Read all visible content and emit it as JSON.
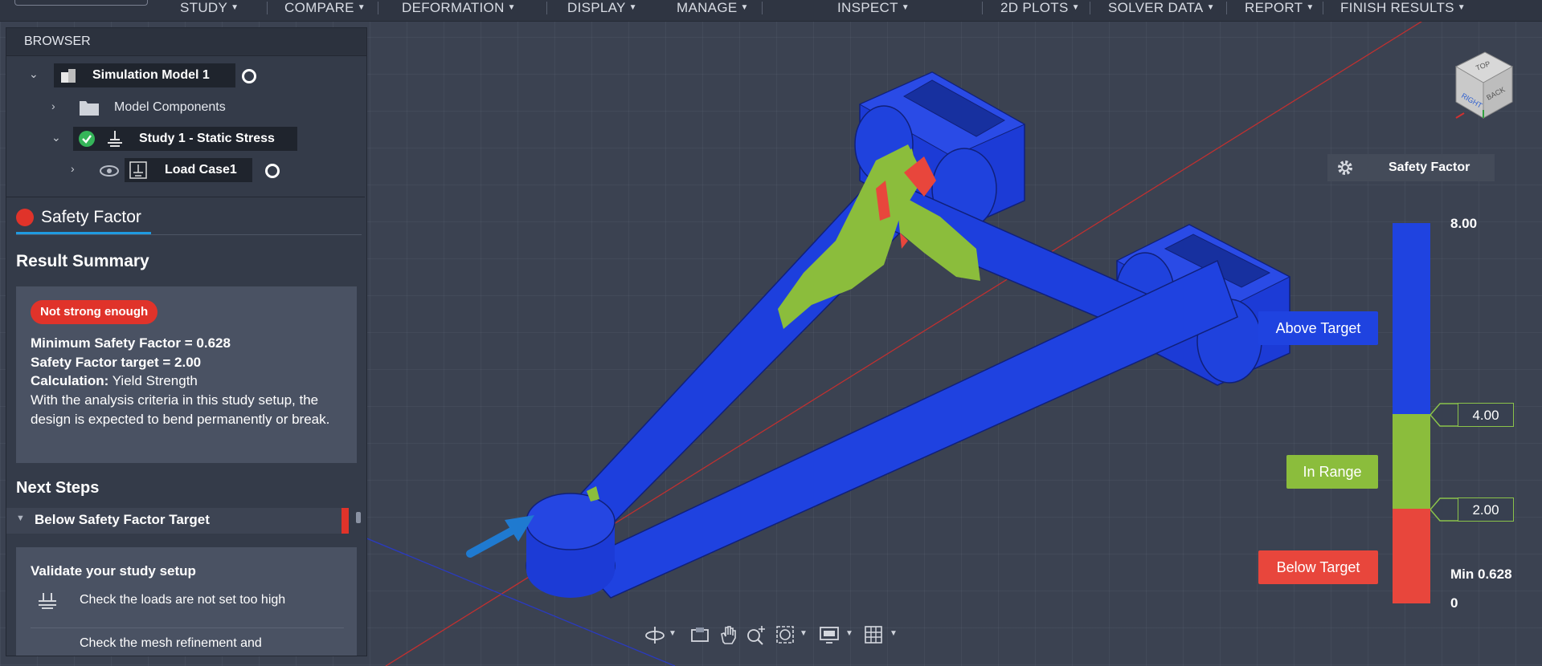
{
  "menu": [
    {
      "label": "STUDY"
    },
    {
      "label": "COMPARE"
    },
    {
      "label": "DEFORMATION"
    },
    {
      "label": "DISPLAY"
    },
    {
      "label": "MANAGE"
    },
    {
      "label": "INSPECT"
    },
    {
      "label": "2D PLOTS"
    },
    {
      "label": "SOLVER DATA"
    },
    {
      "label": "REPORT"
    },
    {
      "label": "FINISH RESULTS"
    }
  ],
  "browser": {
    "title": "BROWSER",
    "tree": {
      "simulation_model": "Simulation Model 1",
      "model_components": "Model Components",
      "study": "Study 1 - Static Stress",
      "load_case": "Load Case1"
    }
  },
  "result_tab": {
    "label": "Safety Factor",
    "color": "#e0332a"
  },
  "result_summary": {
    "title": "Result Summary",
    "status_badge": "Not strong enough",
    "min_safety_factor": "Minimum Safety Factor = 0.628",
    "target": "Safety Factor target = 2.00",
    "calculation_label": "Calculation:",
    "calculation_value": "Yield Strength",
    "description": "With the analysis criteria in this study setup, the design is expected to bend permanently or break."
  },
  "next_steps": {
    "title": "Next Steps",
    "group_label": "Below Safety Factor Target",
    "card_title": "Validate your study setup",
    "items": [
      {
        "text": "Check the loads are not set too high",
        "icon": "loads-icon"
      },
      {
        "text": "Check the mesh refinement and",
        "icon": "mesh-icon"
      }
    ]
  },
  "viewcube": {
    "top": "TOP",
    "right": "RIGHT",
    "back": "BACK"
  },
  "legend": {
    "title": "Safety Factor",
    "max_label": "8.00",
    "upper_threshold": "4.00",
    "lower_threshold": "2.00",
    "min_label": "Min 0.628",
    "zero_label": "0",
    "above_label": "Above Target",
    "in_range_label": "In Range",
    "below_label": "Below Target",
    "colors": {
      "above": "#1f43e0",
      "in_range": "#8bbd3c",
      "below": "#e8463c"
    }
  },
  "nav_toolbar": [
    "orbit-icon",
    "look-at-icon",
    "pan-icon",
    "zoom-icon",
    "fit-icon",
    "display-settings-icon",
    "grid-icon"
  ]
}
